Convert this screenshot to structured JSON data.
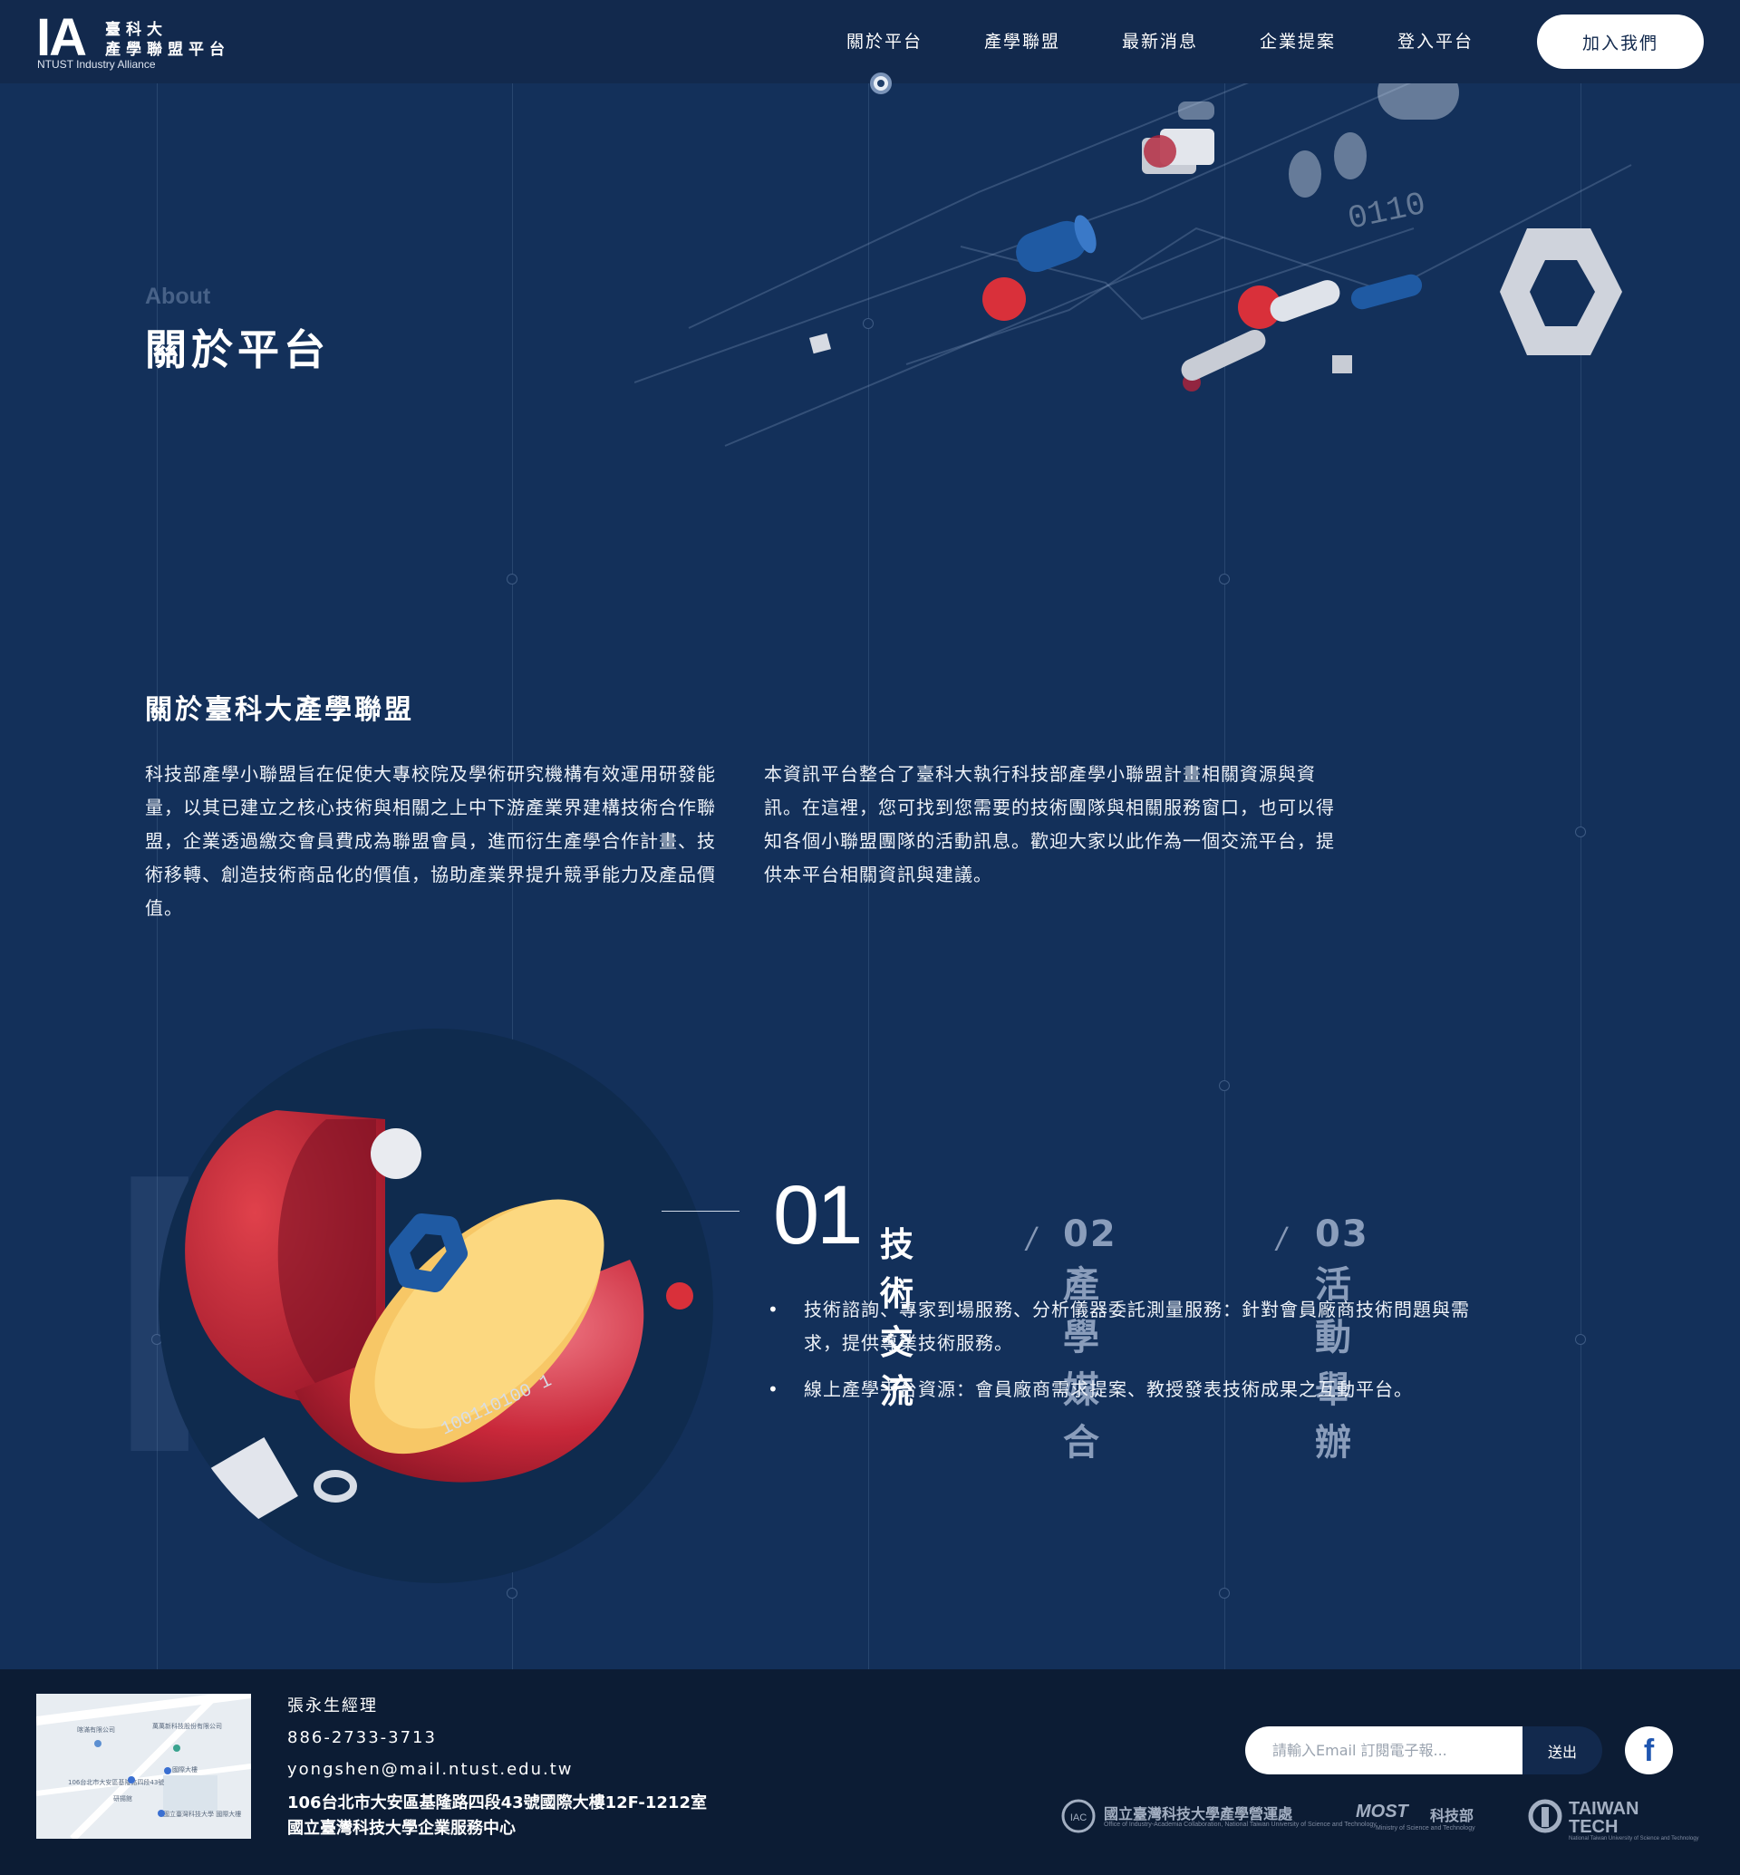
{
  "header": {
    "logo_mark": "IA",
    "logo_zh_line1": "臺科大",
    "logo_zh_line2": "產學聯盟平台",
    "logo_en": "NTUST Industry Alliance",
    "nav": [
      "關於平台",
      "產學聯盟",
      "最新消息",
      "企業提案",
      "登入平台"
    ],
    "active_nav": "關於平台",
    "join_label": "加入我們"
  },
  "hero": {
    "eyebrow": "About",
    "title": "關於平台",
    "art_binary_text": "0110"
  },
  "about": {
    "title": "關於臺科大產學聯盟",
    "paragraph_1": "科技部產學小聯盟旨在促使大專校院及學術研究機構有效運用研發能量，以其已建立之核心技術與相關之上中下游產業界建構技術合作聯盟，企業透過繳交會員費成為聯盟會員，進而衍生產學合作計畫、技術移轉、創造技術商品化的價值，協助產業界提升競爭能力及產品價值。",
    "paragraph_2": "本資訊平台整合了臺科大執行科技部產學小聯盟計畫相關資源與資訊。在這裡，您可找到您需要的技術團隊與相關服務窗口，也可以得知各個小聯盟團隊的活動訊息。歡迎大家以此作為一個交流平台，提供本平台相關資訊與建議。"
  },
  "features": {
    "background_letters": "IA",
    "active_tab": {
      "number": "01",
      "label": "技術交流"
    },
    "tabs": [
      {
        "label": "02產學媒合"
      },
      {
        "label": "03活動舉辦"
      }
    ],
    "separator": "/",
    "bullets": [
      "技術諮詢、專家到場服務、分析儀器委託測量服務：針對會員廠商技術問題與需求，提供專業技術服務。",
      "線上產學平台資源：會員廠商需求提案、教授發表技術成果之互動平台。"
    ],
    "art_binary_text": "100110100 1"
  },
  "footer": {
    "map_labels": [
      "喀滿有限公司",
      "萬萬新科技股份有限公司",
      "國際大樓",
      "106台北市大安區基隆路四段43號",
      "研揚館",
      "國立臺灣科技大學 國際大樓"
    ],
    "contact_name": "張永生經理",
    "contact_phone": "886-2733-3713",
    "contact_email": "yongshen@mail.ntust.edu.tw",
    "address_line1": "106台北市大安區基隆路四段43號國際大樓12F-1212室",
    "address_line2": "國立臺灣科技大學企業服務中心",
    "email_placeholder": "請輸入Email 訂閱電子報...",
    "submit_label": "送出",
    "facebook_glyph": "f",
    "partners": [
      {
        "name": "國立臺灣科技大學產學營運處",
        "sub": "Office of Industry-Academia Collaboration, National Taiwan University of Science and Technology",
        "mark": "IAC"
      },
      {
        "name": "科技部",
        "sub": "Ministry of Science and Technology",
        "mark": "MOST"
      },
      {
        "name": "TAIWAN TECH",
        "sub": "National Taiwan University of Science and Technology"
      }
    ]
  },
  "colors": {
    "background": "#13305a",
    "header": "#12294d",
    "footer": "#0c1c34",
    "accent_red": "#d9303a",
    "accent_blue": "#1f5aa3",
    "accent_yellow": "#f5c35e",
    "muted_text": "#8a9dbb"
  }
}
